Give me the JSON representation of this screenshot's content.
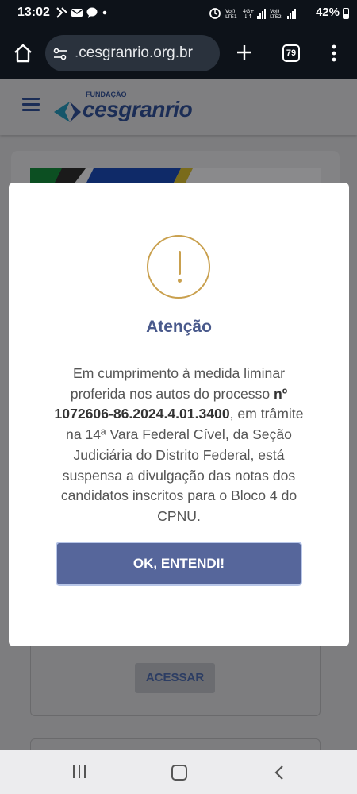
{
  "status_bar": {
    "time": "13:02",
    "left_icons": "⛓ ✉ 💬 •",
    "right_icons": "⏰ LTE1 4G+ LTE2 📶",
    "battery": "42%"
  },
  "browser": {
    "url_prefix": "",
    "url_domain": "cesgranrio.org.br",
    "tab_count": "79"
  },
  "page": {
    "logo_small": "FUNDAÇÃO",
    "logo_main": "cesgranrio",
    "accent_color": "#1b2d56",
    "acessar_label": "ACESSAR"
  },
  "modal": {
    "title": "Atenção",
    "body_part1": "Em cumprimento à medida liminar proferida nos autos do processo ",
    "body_bold1": "nº 1072606-86.2024.4.01.3400",
    "body_part2": ", em trâmite na 14ª Vara Federal Cível, da Seção Judiciária do Distrito Federal, está suspensa a divulgação das notas dos candidatos inscritos para o Bloco 4 do CPNU.",
    "ok_label": "OK, ENTENDI!",
    "button_color": "#56669b",
    "icon_color": "#c9a04e"
  }
}
